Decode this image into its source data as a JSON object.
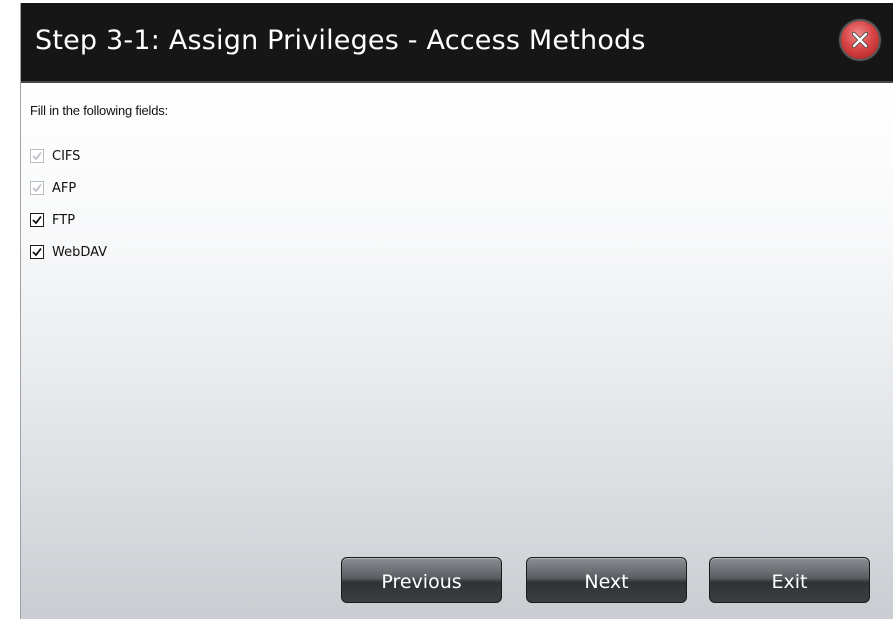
{
  "dialog": {
    "title": "Step 3-1: Assign Privileges - Access Methods",
    "instructions": "Fill in the following fields:"
  },
  "options": [
    {
      "label": "CIFS",
      "checked": true,
      "disabled": true
    },
    {
      "label": "AFP",
      "checked": true,
      "disabled": true
    },
    {
      "label": "FTP",
      "checked": true,
      "disabled": false
    },
    {
      "label": "WebDAV",
      "checked": true,
      "disabled": false
    }
  ],
  "buttons": {
    "previous": "Previous",
    "next": "Next",
    "exit": "Exit"
  },
  "icons": {
    "close": "close-icon",
    "check": "checkmark-icon"
  },
  "colors": {
    "titlebar": "#161616",
    "close_red": "#d94646",
    "button_dark": "#3b3f42"
  }
}
